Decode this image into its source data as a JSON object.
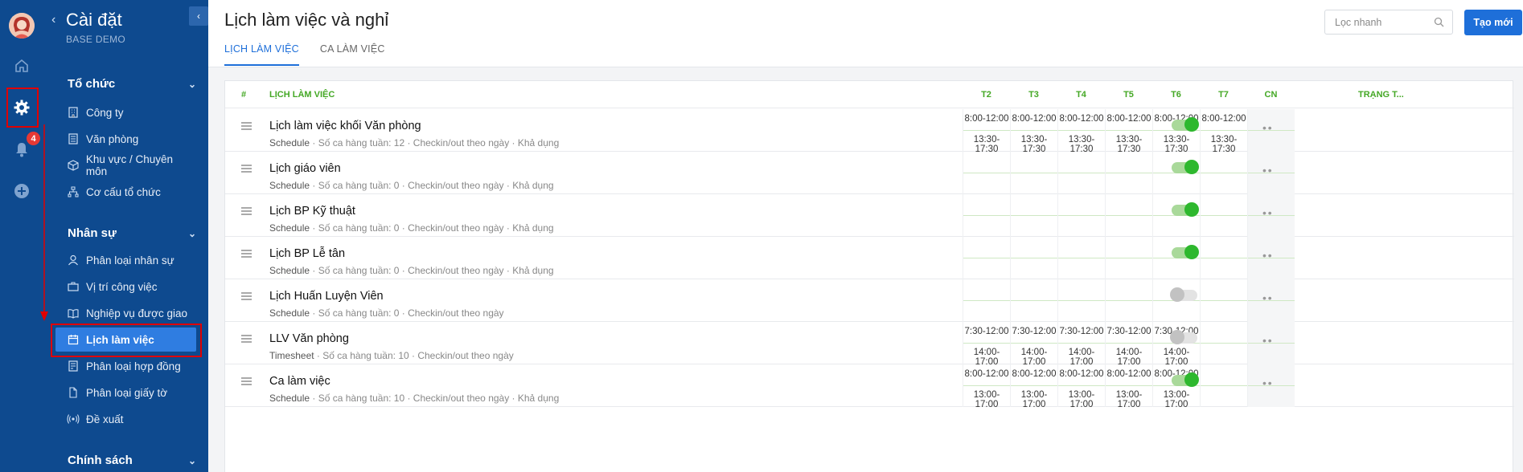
{
  "app": {
    "title": "Cài đặt",
    "subtitle": "BASE DEMO",
    "notification_count": "4"
  },
  "sidebar": {
    "sections": [
      {
        "label": "Tổ chức",
        "items": [
          {
            "label": "Công ty",
            "icon": "building-icon"
          },
          {
            "label": "Văn phòng",
            "icon": "office-icon"
          },
          {
            "label": "Khu vực / Chuyên môn",
            "icon": "cube-icon"
          },
          {
            "label": "Cơ cấu tổ chức",
            "icon": "org-chart-icon"
          }
        ]
      },
      {
        "label": "Nhân sự",
        "items": [
          {
            "label": "Phân loại nhân sự",
            "icon": "user-icon"
          },
          {
            "label": "Vị trí công việc",
            "icon": "briefcase-icon"
          },
          {
            "label": "Nghiệp vụ được giao",
            "icon": "book-icon"
          },
          {
            "label": "Lịch làm việc",
            "icon": "calendar-icon",
            "active": true
          },
          {
            "label": "Phân loại hợp đồng",
            "icon": "contract-icon"
          },
          {
            "label": "Phân loại giấy tờ",
            "icon": "document-icon"
          },
          {
            "label": "Đề xuất",
            "icon": "broadcast-icon"
          }
        ]
      },
      {
        "label": "Chính sách",
        "items": []
      }
    ]
  },
  "header": {
    "title": "Lịch làm việc và nghỉ",
    "tabs": [
      {
        "label": "LỊCH LÀM VIỆC",
        "active": true
      },
      {
        "label": "CA LÀM VIỆC",
        "active": false
      }
    ],
    "search_placeholder": "Lọc nhanh",
    "create_label": "Tạo mới"
  },
  "table": {
    "columns": {
      "index": "#",
      "name": "LỊCH LÀM VIỆC",
      "days": [
        "T2",
        "T3",
        "T4",
        "T5",
        "T6",
        "T7",
        "CN"
      ],
      "status": "TRẠNG T..."
    },
    "rows": [
      {
        "name": "Lịch làm việc khối Văn phòng",
        "type": "Schedule",
        "meta": " · Số ca hàng tuần: 12 · Checkin/out theo ngày · Khả dụng",
        "slots": [
          [
            "8:00-12:00",
            "13:30-17:30"
          ],
          [
            "8:00-12:00",
            "13:30-17:30"
          ],
          [
            "8:00-12:00",
            "13:30-17:30"
          ],
          [
            "8:00-12:00",
            "13:30-17:30"
          ],
          [
            "8:00-12:00",
            "13:30-17:30"
          ],
          [
            "8:00-12:00",
            "13:30-17:30"
          ],
          [
            "",
            ""
          ]
        ],
        "enabled": true
      },
      {
        "name": "Lịch giáo viên",
        "type": "Schedule",
        "meta": " · Số ca hàng tuần: 0 · Checkin/out theo ngày · Khả dụng",
        "slots": [
          [
            "",
            ""
          ],
          [
            "",
            ""
          ],
          [
            "",
            ""
          ],
          [
            "",
            ""
          ],
          [
            "",
            ""
          ],
          [
            "",
            ""
          ],
          [
            "",
            ""
          ]
        ],
        "enabled": true
      },
      {
        "name": "Lịch BP Kỹ thuật",
        "type": "Schedule",
        "meta": " · Số ca hàng tuần: 0 · Checkin/out theo ngày · Khả dụng",
        "slots": [
          [
            "",
            ""
          ],
          [
            "",
            ""
          ],
          [
            "",
            ""
          ],
          [
            "",
            ""
          ],
          [
            "",
            ""
          ],
          [
            "",
            ""
          ],
          [
            "",
            ""
          ]
        ],
        "enabled": true
      },
      {
        "name": "Lịch BP Lễ tân",
        "type": "Schedule",
        "meta": " · Số ca hàng tuần: 0 · Checkin/out theo ngày · Khả dụng",
        "slots": [
          [
            "",
            ""
          ],
          [
            "",
            ""
          ],
          [
            "",
            ""
          ],
          [
            "",
            ""
          ],
          [
            "",
            ""
          ],
          [
            "",
            ""
          ],
          [
            "",
            ""
          ]
        ],
        "enabled": true
      },
      {
        "name": "Lịch Huấn Luyện Viên",
        "type": "Schedule",
        "meta": " · Số ca hàng tuần: 0 · Checkin/out theo ngày",
        "slots": [
          [
            "",
            ""
          ],
          [
            "",
            ""
          ],
          [
            "",
            ""
          ],
          [
            "",
            ""
          ],
          [
            "",
            ""
          ],
          [
            "",
            ""
          ],
          [
            "",
            ""
          ]
        ],
        "enabled": false
      },
      {
        "name": "LLV Văn phòng",
        "type": "Timesheet",
        "meta": " · Số ca hàng tuần: 10 · Checkin/out theo ngày",
        "slots": [
          [
            "7:30-12:00",
            "14:00-17:00"
          ],
          [
            "7:30-12:00",
            "14:00-17:00"
          ],
          [
            "7:30-12:00",
            "14:00-17:00"
          ],
          [
            "7:30-12:00",
            "14:00-17:00"
          ],
          [
            "7:30-12:00",
            "14:00-17:00"
          ],
          [
            "",
            ""
          ],
          [
            "",
            ""
          ]
        ],
        "enabled": false
      },
      {
        "name": "Ca làm việc",
        "type": "Schedule",
        "meta": " · Số ca hàng tuần: 10 · Checkin/out theo ngày · Khả dụng",
        "slots": [
          [
            "8:00-12:00",
            "13:00-17:00"
          ],
          [
            "8:00-12:00",
            "13:00-17:00"
          ],
          [
            "8:00-12:00",
            "13:00-17:00"
          ],
          [
            "8:00-12:00",
            "13:00-17:00"
          ],
          [
            "8:00-12:00",
            "13:00-17:00"
          ],
          [
            "",
            ""
          ],
          [
            "",
            ""
          ]
        ],
        "enabled": true
      }
    ]
  },
  "colors": {
    "sidebar": "#0e4a8f",
    "accent": "#1e6fd9",
    "header_green": "#44a825",
    "toggle_on": "#2eb82e",
    "annotation": "#e00000"
  }
}
